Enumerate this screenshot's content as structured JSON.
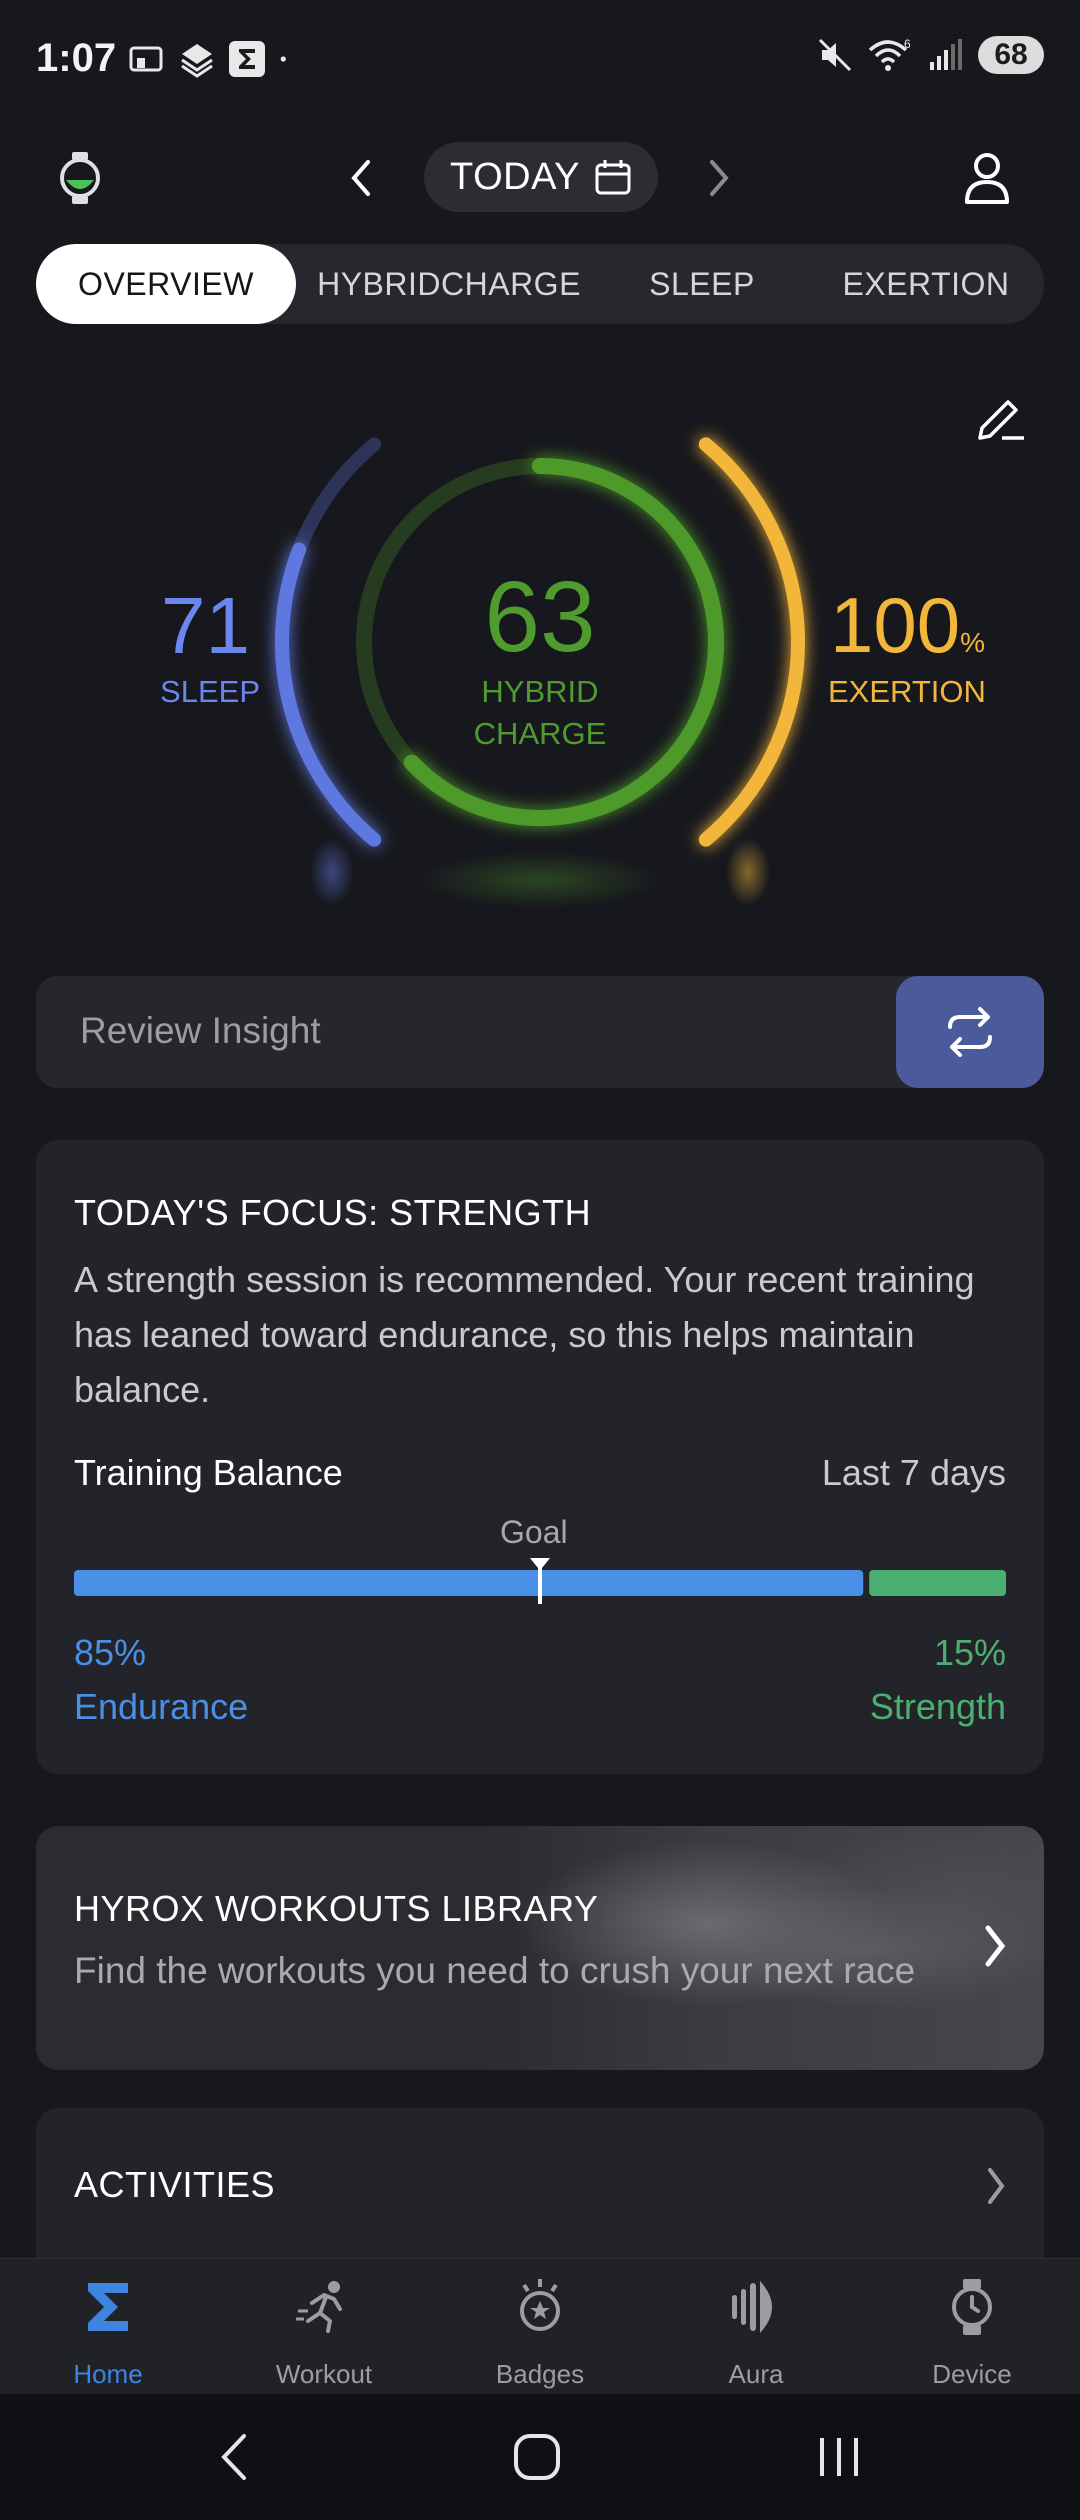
{
  "status_bar": {
    "time": "1:07",
    "battery": "68",
    "signal_label": "6"
  },
  "header": {
    "date_label": "TODAY"
  },
  "tabs": [
    {
      "label": "OVERVIEW",
      "active": true
    },
    {
      "label": "HYBRIDCHARGE",
      "active": false
    },
    {
      "label": "SLEEP",
      "active": false
    },
    {
      "label": "EXERTION",
      "active": false
    }
  ],
  "gauge": {
    "sleep_value": "71",
    "sleep_label": "SLEEP",
    "hybrid_value": "63",
    "hybrid_label_line1": "HYBRID",
    "hybrid_label_line2": "CHARGE",
    "exertion_value": "100",
    "exertion_unit": "%",
    "exertion_label": "EXERTION",
    "sleep_fill": 0.71,
    "hybrid_fill": 0.63,
    "exertion_fill": 1.0,
    "colors": {
      "sleep": "#5f78e0",
      "hybrid": "#4e9a2c",
      "exertion": "#f2b63a"
    }
  },
  "insight": {
    "text": "Review Insight"
  },
  "focus": {
    "title": "TODAY'S FOCUS: STRENGTH",
    "body": "A strength session is recommended. Your recent training has leaned toward endurance, so this helps maintain balance.",
    "training_balance_label": "Training Balance",
    "range_label": "Last 7 days",
    "goal_label": "Goal",
    "endurance_pct": "85%",
    "endurance_label": "Endurance",
    "strength_pct": "15%",
    "strength_label": "Strength",
    "endurance_fraction": 0.85,
    "goal_fraction": 0.5,
    "colors": {
      "endurance": "#4a8fe6",
      "strength": "#4caf72"
    }
  },
  "hyrox": {
    "title": "HYROX WORKOUTS LIBRARY",
    "subtitle": "Find the workouts you need to crush your next race"
  },
  "activities": {
    "title": "ACTIVITIES"
  },
  "bottom_nav": [
    {
      "label": "Home",
      "icon": "sigma-icon",
      "active": true
    },
    {
      "label": "Workout",
      "icon": "running-icon",
      "active": false
    },
    {
      "label": "Badges",
      "icon": "badge-icon",
      "active": false
    },
    {
      "label": "Aura",
      "icon": "aura-icon",
      "active": false
    },
    {
      "label": "Device",
      "icon": "watch-icon",
      "active": false
    }
  ]
}
